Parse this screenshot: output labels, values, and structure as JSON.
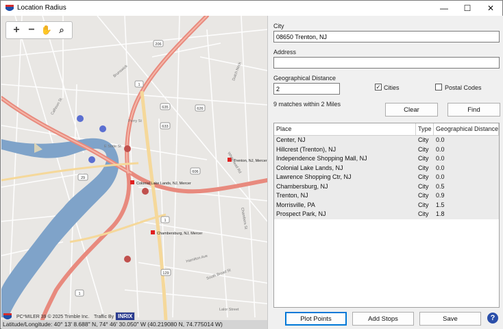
{
  "window": {
    "title": "Location Radius",
    "minimize_glyph": "—",
    "maximize_glyph": "☐",
    "close_glyph": "✕"
  },
  "map": {
    "toolbar": {
      "zoom_in": "+",
      "zoom_out": "−",
      "pan": "✋",
      "zoom_box": "⌕"
    },
    "place_labels": {
      "trenton": "Trenton, NJ, Mercer",
      "colonial": "Colonial Lake Lands, NJ, Mercer",
      "chambersburg": "Chambersburg, NJ, Mercer"
    },
    "route_shields": [
      "206",
      "1",
      "29",
      "633",
      "626",
      "635",
      "606",
      "129",
      "1",
      "1"
    ],
    "street_labels": [
      "Brunswick",
      "Calhoun St",
      "Perry St",
      "E State St",
      "Chambers St",
      "Dutch Neck",
      "Lalor Street",
      "South Broad St",
      "Hamilton Ave",
      "Whitehead Rd"
    ],
    "copyright": "PC*MILER 39  © 2025 Trimble Inc.",
    "traffic_by": "Traffic By",
    "inrix": "INRIX",
    "status": "Latitude/Longitude: 40° 13' 8.688\" N,  74° 46' 30.050\" W (40.219080 N, 74.775014 W)"
  },
  "form": {
    "city_label": "City",
    "city_value": "08650 Trenton, NJ",
    "address_label": "Address",
    "address_value": "",
    "distance_label": "Geographical Distance",
    "distance_value": "2",
    "cities_label": "Cities",
    "cities_checked": true,
    "postal_label": "Postal Codes",
    "postal_checked": false,
    "matches_text": "9 matches within 2 Miles",
    "clear_label": "Clear",
    "find_label": "Find"
  },
  "results": {
    "columns": [
      "Place",
      "Type",
      "Geographical Distance"
    ],
    "rows": [
      {
        "place": "Center, NJ",
        "type": "City",
        "distance": "0.0"
      },
      {
        "place": "Hillcrest (Trenton), NJ",
        "type": "City",
        "distance": "0.0"
      },
      {
        "place": "Independence Shopping Mall, NJ",
        "type": "City",
        "distance": "0.0"
      },
      {
        "place": "Colonial Lake Lands, NJ",
        "type": "City",
        "distance": "0.0"
      },
      {
        "place": "Lawrence Shopping Ctr, NJ",
        "type": "City",
        "distance": "0.0"
      },
      {
        "place": "Chambersburg, NJ",
        "type": "City",
        "distance": "0.5"
      },
      {
        "place": "Trenton, NJ",
        "type": "City",
        "distance": "0.9"
      },
      {
        "place": "Morrisville, PA",
        "type": "City",
        "distance": "1.5"
      },
      {
        "place": "Prospect Park, NJ",
        "type": "City",
        "distance": "1.8"
      }
    ]
  },
  "actions": {
    "plot_points": "Plot Points",
    "add_stops": "Add Stops",
    "save": "Save",
    "help": "?"
  },
  "colors": {
    "map_bg": "#e9e7e4",
    "river": "#7fa3c9",
    "highway": "#e88a7e",
    "major_road": "#f5d89a",
    "marker": "#e02020",
    "accent": "#0078d7"
  }
}
